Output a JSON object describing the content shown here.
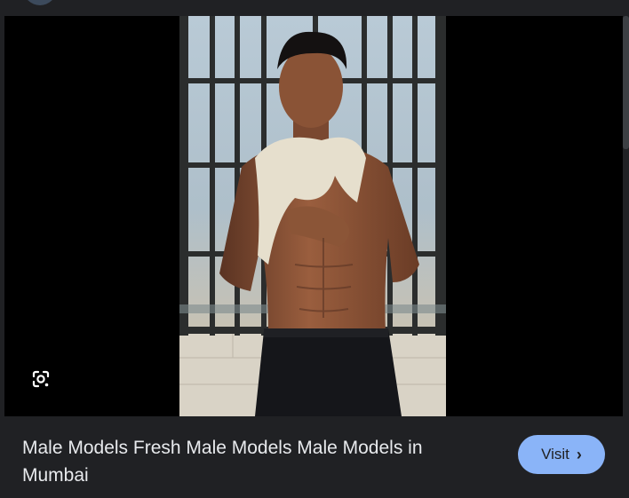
{
  "result": {
    "title": "Male Models Fresh Male Models Male Models in Mumbai",
    "visit_label": "Visit",
    "visit_icon": "chevron-right-icon",
    "lens_icon": "google-lens-icon"
  },
  "colors": {
    "background": "#202124",
    "media_background": "#000000",
    "button": "#8ab4f8",
    "title_text": "#e8eaed"
  }
}
